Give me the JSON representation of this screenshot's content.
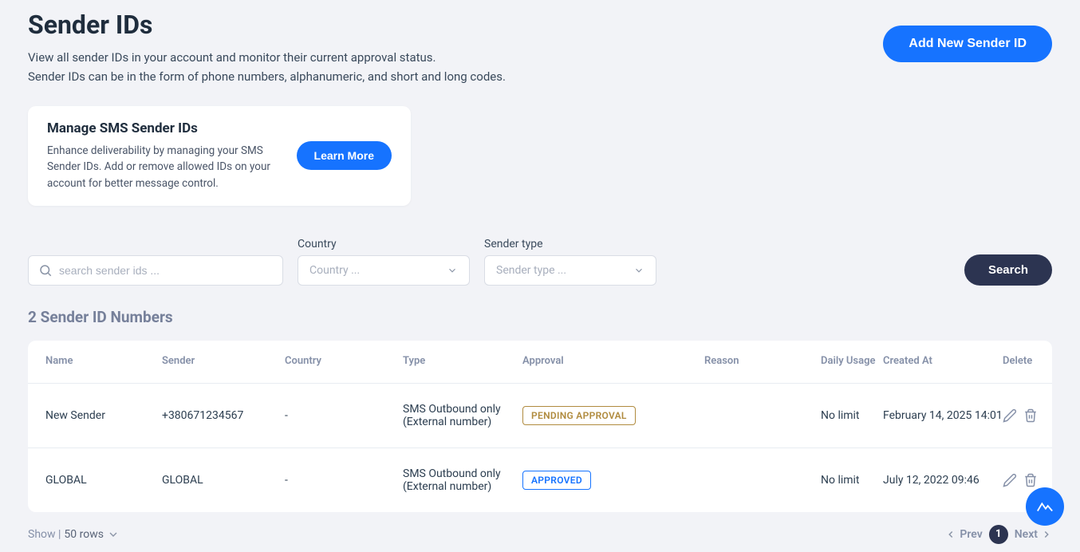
{
  "header": {
    "title": "Sender IDs",
    "subtitle1": "View all sender IDs in your account and monitor their current approval status.",
    "subtitle2": "Sender IDs can be in the form of phone numbers, alphanumeric, and short and long codes.",
    "add_button": "Add New Sender ID"
  },
  "card": {
    "title": "Manage SMS Sender IDs",
    "text": "Enhance deliverability by managing your SMS Sender IDs. Add or remove allowed IDs on your account for better message control.",
    "learn_button": "Learn More"
  },
  "filters": {
    "search_placeholder": "search sender ids ...",
    "country_label": "Country",
    "country_placeholder": "Country ...",
    "type_label": "Sender type",
    "type_placeholder": "Sender type ...",
    "search_button": "Search"
  },
  "section_title": "2 Sender ID Numbers",
  "table": {
    "headers": {
      "name": "Name",
      "sender": "Sender",
      "country": "Country",
      "type": "Type",
      "approval": "Approval",
      "reason": "Reason",
      "usage": "Daily Usage",
      "created": "Created At",
      "delete": "Delete"
    },
    "rows": [
      {
        "name": "New Sender",
        "sender": "+380671234567",
        "country": "-",
        "type": "SMS Outbound only (External number)",
        "approval": "PENDING APPROVAL",
        "approval_class": "badge-pending",
        "reason": "",
        "usage": "No limit",
        "created": "February 14, 2025 14:01"
      },
      {
        "name": "GLOBAL",
        "sender": "GLOBAL",
        "country": "-",
        "type": "SMS Outbound only (External number)",
        "approval": "APPROVED",
        "approval_class": "badge-approved",
        "reason": "",
        "usage": "No limit",
        "created": "July 12, 2022 09:46"
      }
    ]
  },
  "footer": {
    "show_label": "Show | ",
    "rows_label": "50 rows",
    "prev": "Prev",
    "next": "Next",
    "page": "1"
  }
}
